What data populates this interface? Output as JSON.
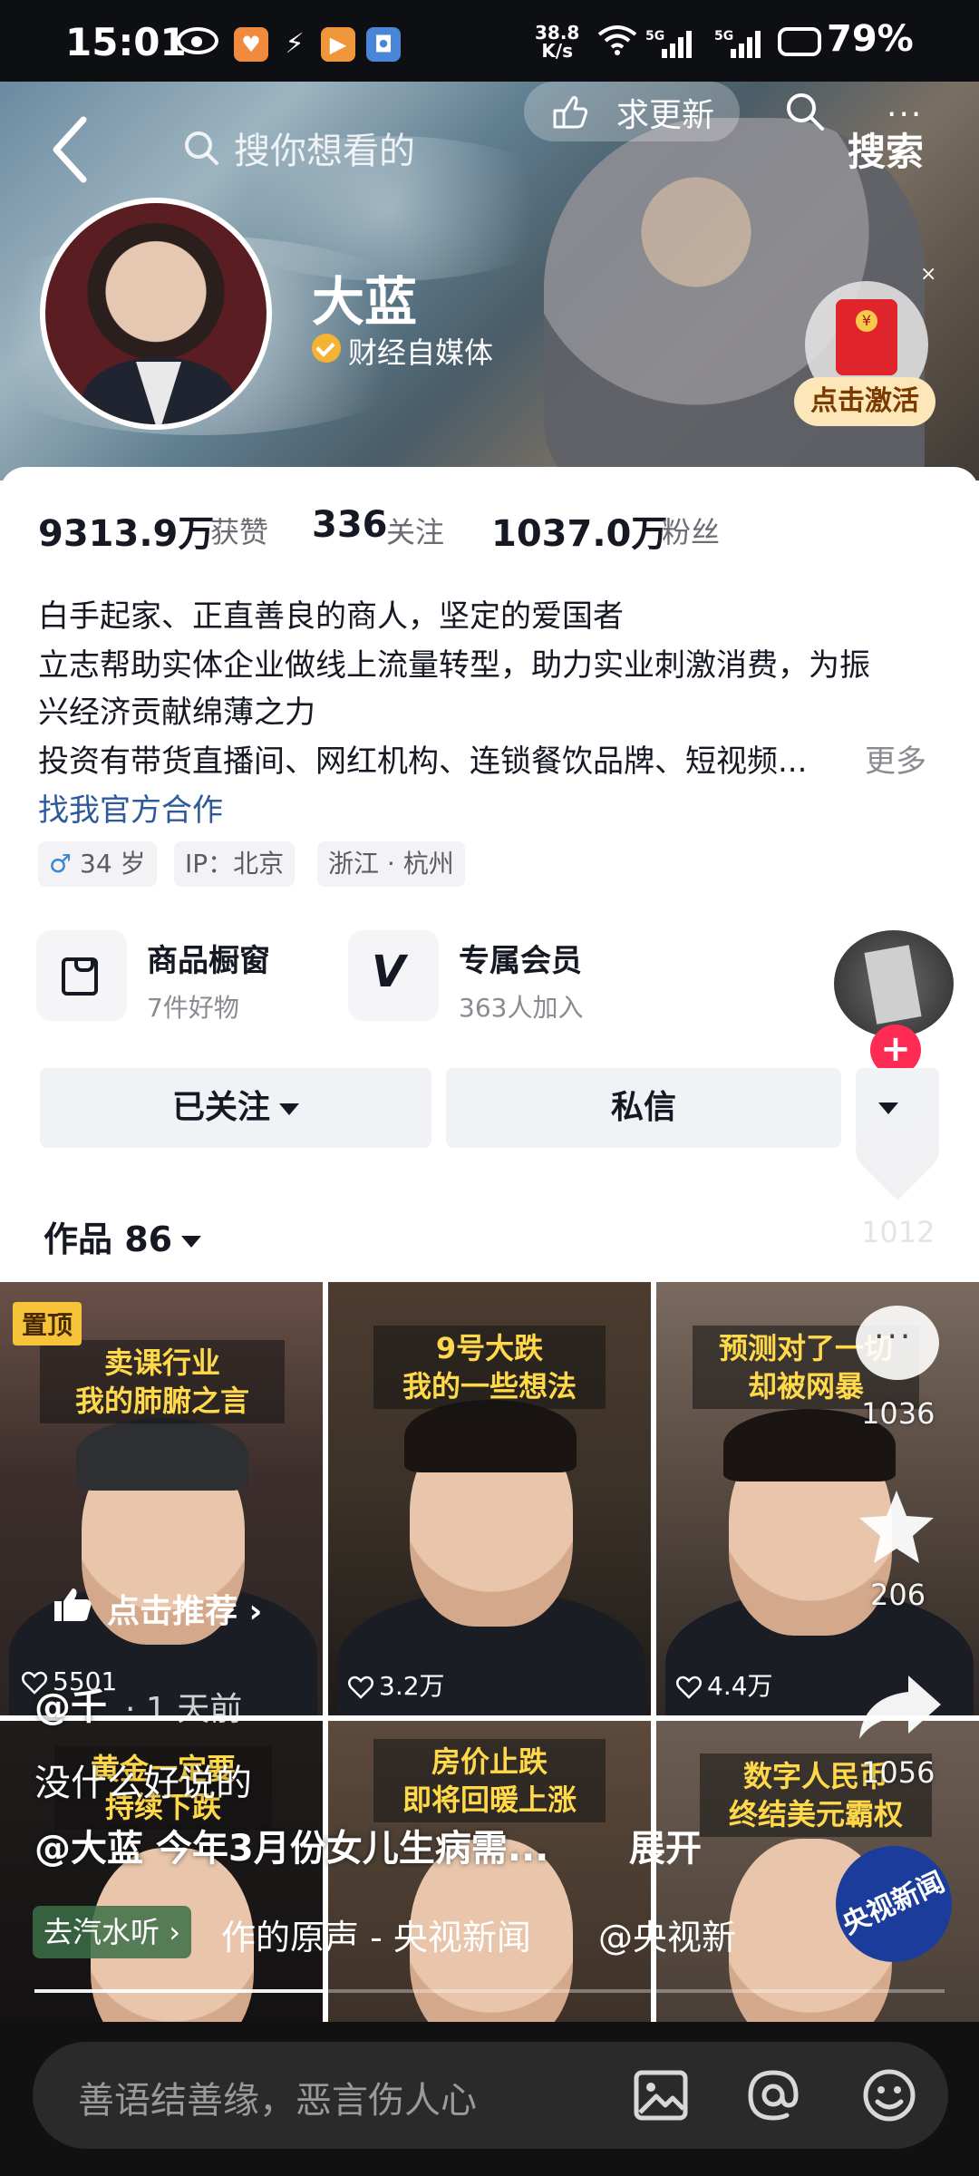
{
  "status_bar": {
    "time": "15:01",
    "net_speed_top": "38.8",
    "net_speed_bottom": "K/s",
    "sig1": "5G",
    "sig2": "5G",
    "battery": "79%"
  },
  "header": {
    "search_placeholder": "搜你想看的",
    "update_label": "求更新",
    "more_label": "···",
    "search_button": "搜索"
  },
  "profile": {
    "name": "大蓝",
    "verify_label": "财经自媒体",
    "activate_label": "点击激活",
    "close_label": "×"
  },
  "stats": [
    {
      "value": "9313.9万",
      "label": "获赞"
    },
    {
      "value": "336",
      "label": "关注"
    },
    {
      "value": "1037.0万",
      "label": "粉丝"
    }
  ],
  "bio": {
    "line1": "白手起家、正直善良的商人，坚定的爱国者",
    "line2": "立志帮助实体企业做线上流量转型，助力实业刺激消费，为振",
    "line3": "兴经济贡献绵薄之力",
    "line4": "投资有带货直播间、网红机构、连锁餐饮品牌、短视频...",
    "more": "更多",
    "link": "找我官方合作"
  },
  "tags": {
    "gender_icon": "♂",
    "age": "34 岁",
    "ip": "IP：北京",
    "location": "浙江 · 杭州"
  },
  "features": [
    {
      "title": "商品橱窗",
      "sub": "7件好物"
    },
    {
      "title": "专属会员",
      "sub": "363人加入"
    }
  ],
  "actions": {
    "follow": "已关注",
    "message": "私信"
  },
  "side_actions": {
    "plus": "+",
    "like_count": "1012",
    "comment_count": "1036",
    "star_count": "206",
    "share_count": "1056"
  },
  "works": {
    "label": "作品 86"
  },
  "videos": [
    {
      "pin": "置顶",
      "caption1": "卖课行业",
      "caption2": "我的肺腑之言",
      "likes": "5501"
    },
    {
      "caption1": "9号大跌",
      "caption2": "我的一些想法",
      "likes": "3.2万"
    },
    {
      "caption1": "预测对了一切",
      "caption2": "却被网暴",
      "likes": "4.4万"
    },
    {
      "caption1": "黄金一定要",
      "caption2": "持续下跌"
    },
    {
      "caption1": "房价止跌",
      "caption2": "即将回暖上涨"
    },
    {
      "caption1": "数字人民币",
      "caption2": "终结美元霸权"
    }
  ],
  "recommend": "点击推荐",
  "overlay": {
    "user": "@千",
    "time": "· 1 天前",
    "line1": "没什么好说的",
    "line2": "@大蓝 今年3月份女儿生病需...",
    "expand": "展开",
    "music_tag": "去汽水听",
    "music_text": "作的原声 - 央视新闻",
    "music_at": "@央视新",
    "badge": "央视新闻",
    "progress": 0.32
  },
  "comment_bar": {
    "placeholder": "善语结善缘，恶言伤人心"
  }
}
